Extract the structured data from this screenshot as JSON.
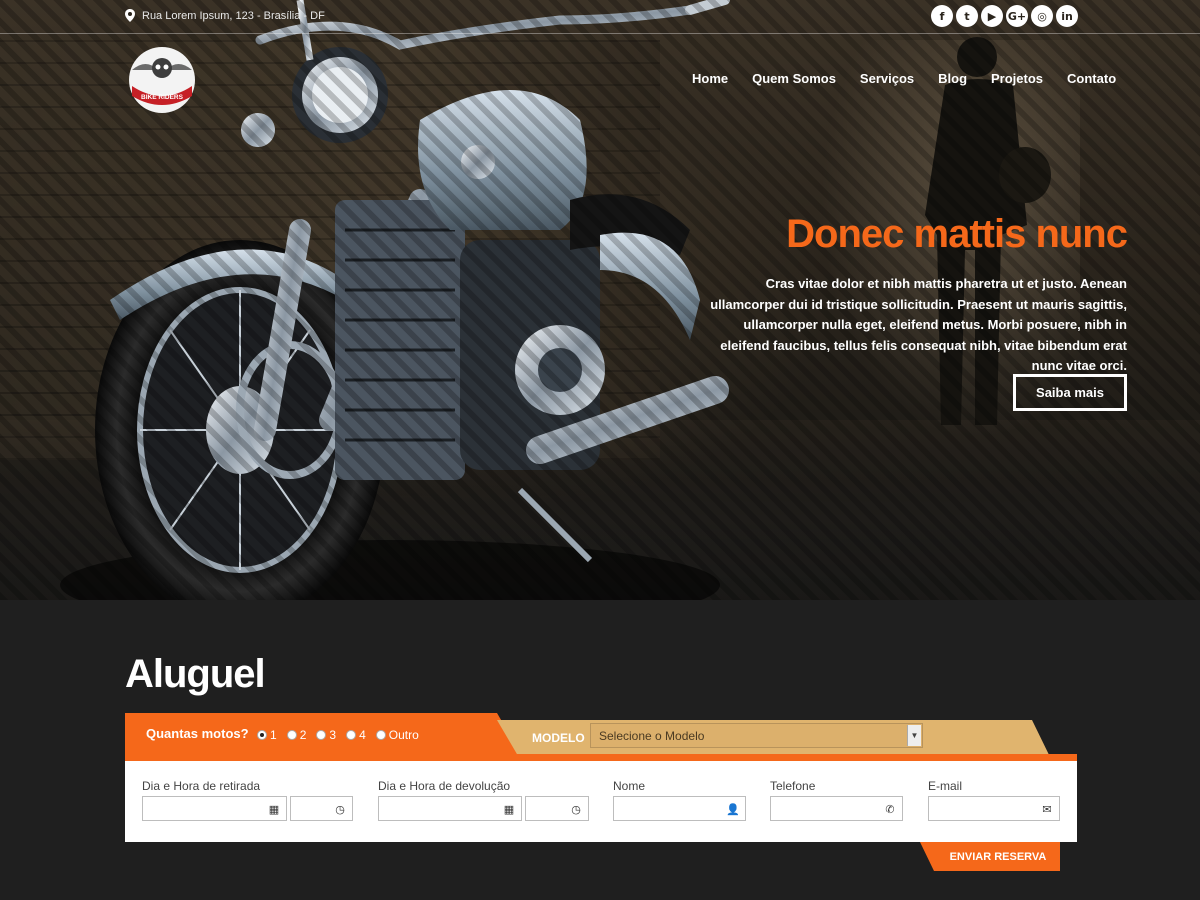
{
  "topbar": {
    "address": "Rua Lorem Ipsum, 123 - Brasília - DF",
    "address_icon": "map-marker-icon",
    "socials": [
      {
        "name": "facebook-icon",
        "glyph": "f"
      },
      {
        "name": "twitter-icon",
        "glyph": "t"
      },
      {
        "name": "youtube-icon",
        "glyph": "▶"
      },
      {
        "name": "google-plus-icon",
        "glyph": "G+"
      },
      {
        "name": "instagram-icon",
        "glyph": "◎"
      },
      {
        "name": "linkedin-icon",
        "glyph": "in"
      }
    ]
  },
  "logo": {
    "text": "BIKE RIDERS"
  },
  "nav": {
    "items": [
      "Home",
      "Quem Somos",
      "Serviços",
      "Blog",
      "Projetos",
      "Contato"
    ]
  },
  "hero": {
    "title": "Donec mattis nunc",
    "text": "Cras vitae dolor et nibh mattis pharetra ut et justo. Aenean ullamcorper dui id tristique sollicitudin. Praesent ut mauris sagittis, ullamcorper nulla eget, eleifend metus. Morbi posuere, nibh in eleifend faucibus, tellus felis consequat nibh, vitae bibendum erat nunc vitae orci.",
    "cta": "Saiba mais"
  },
  "rental": {
    "title": "Aluguel",
    "qty_label": "Quantas motos?",
    "qty_options": [
      "1",
      "2",
      "3",
      "4",
      "Outro"
    ],
    "qty_selected": "1",
    "model_label": "MODELO",
    "model_select": "Selecione o Modelo",
    "fields": {
      "pickup": "Dia e Hora de retirada",
      "return": "Dia e Hora de devolução",
      "name": "Nome",
      "phone": "Telefone",
      "email": "E-mail"
    },
    "submit": "ENVIAR RESERVA"
  },
  "colors": {
    "accent": "#f5681a",
    "tan": "#e0b46e",
    "background": "#1f1f1f"
  }
}
